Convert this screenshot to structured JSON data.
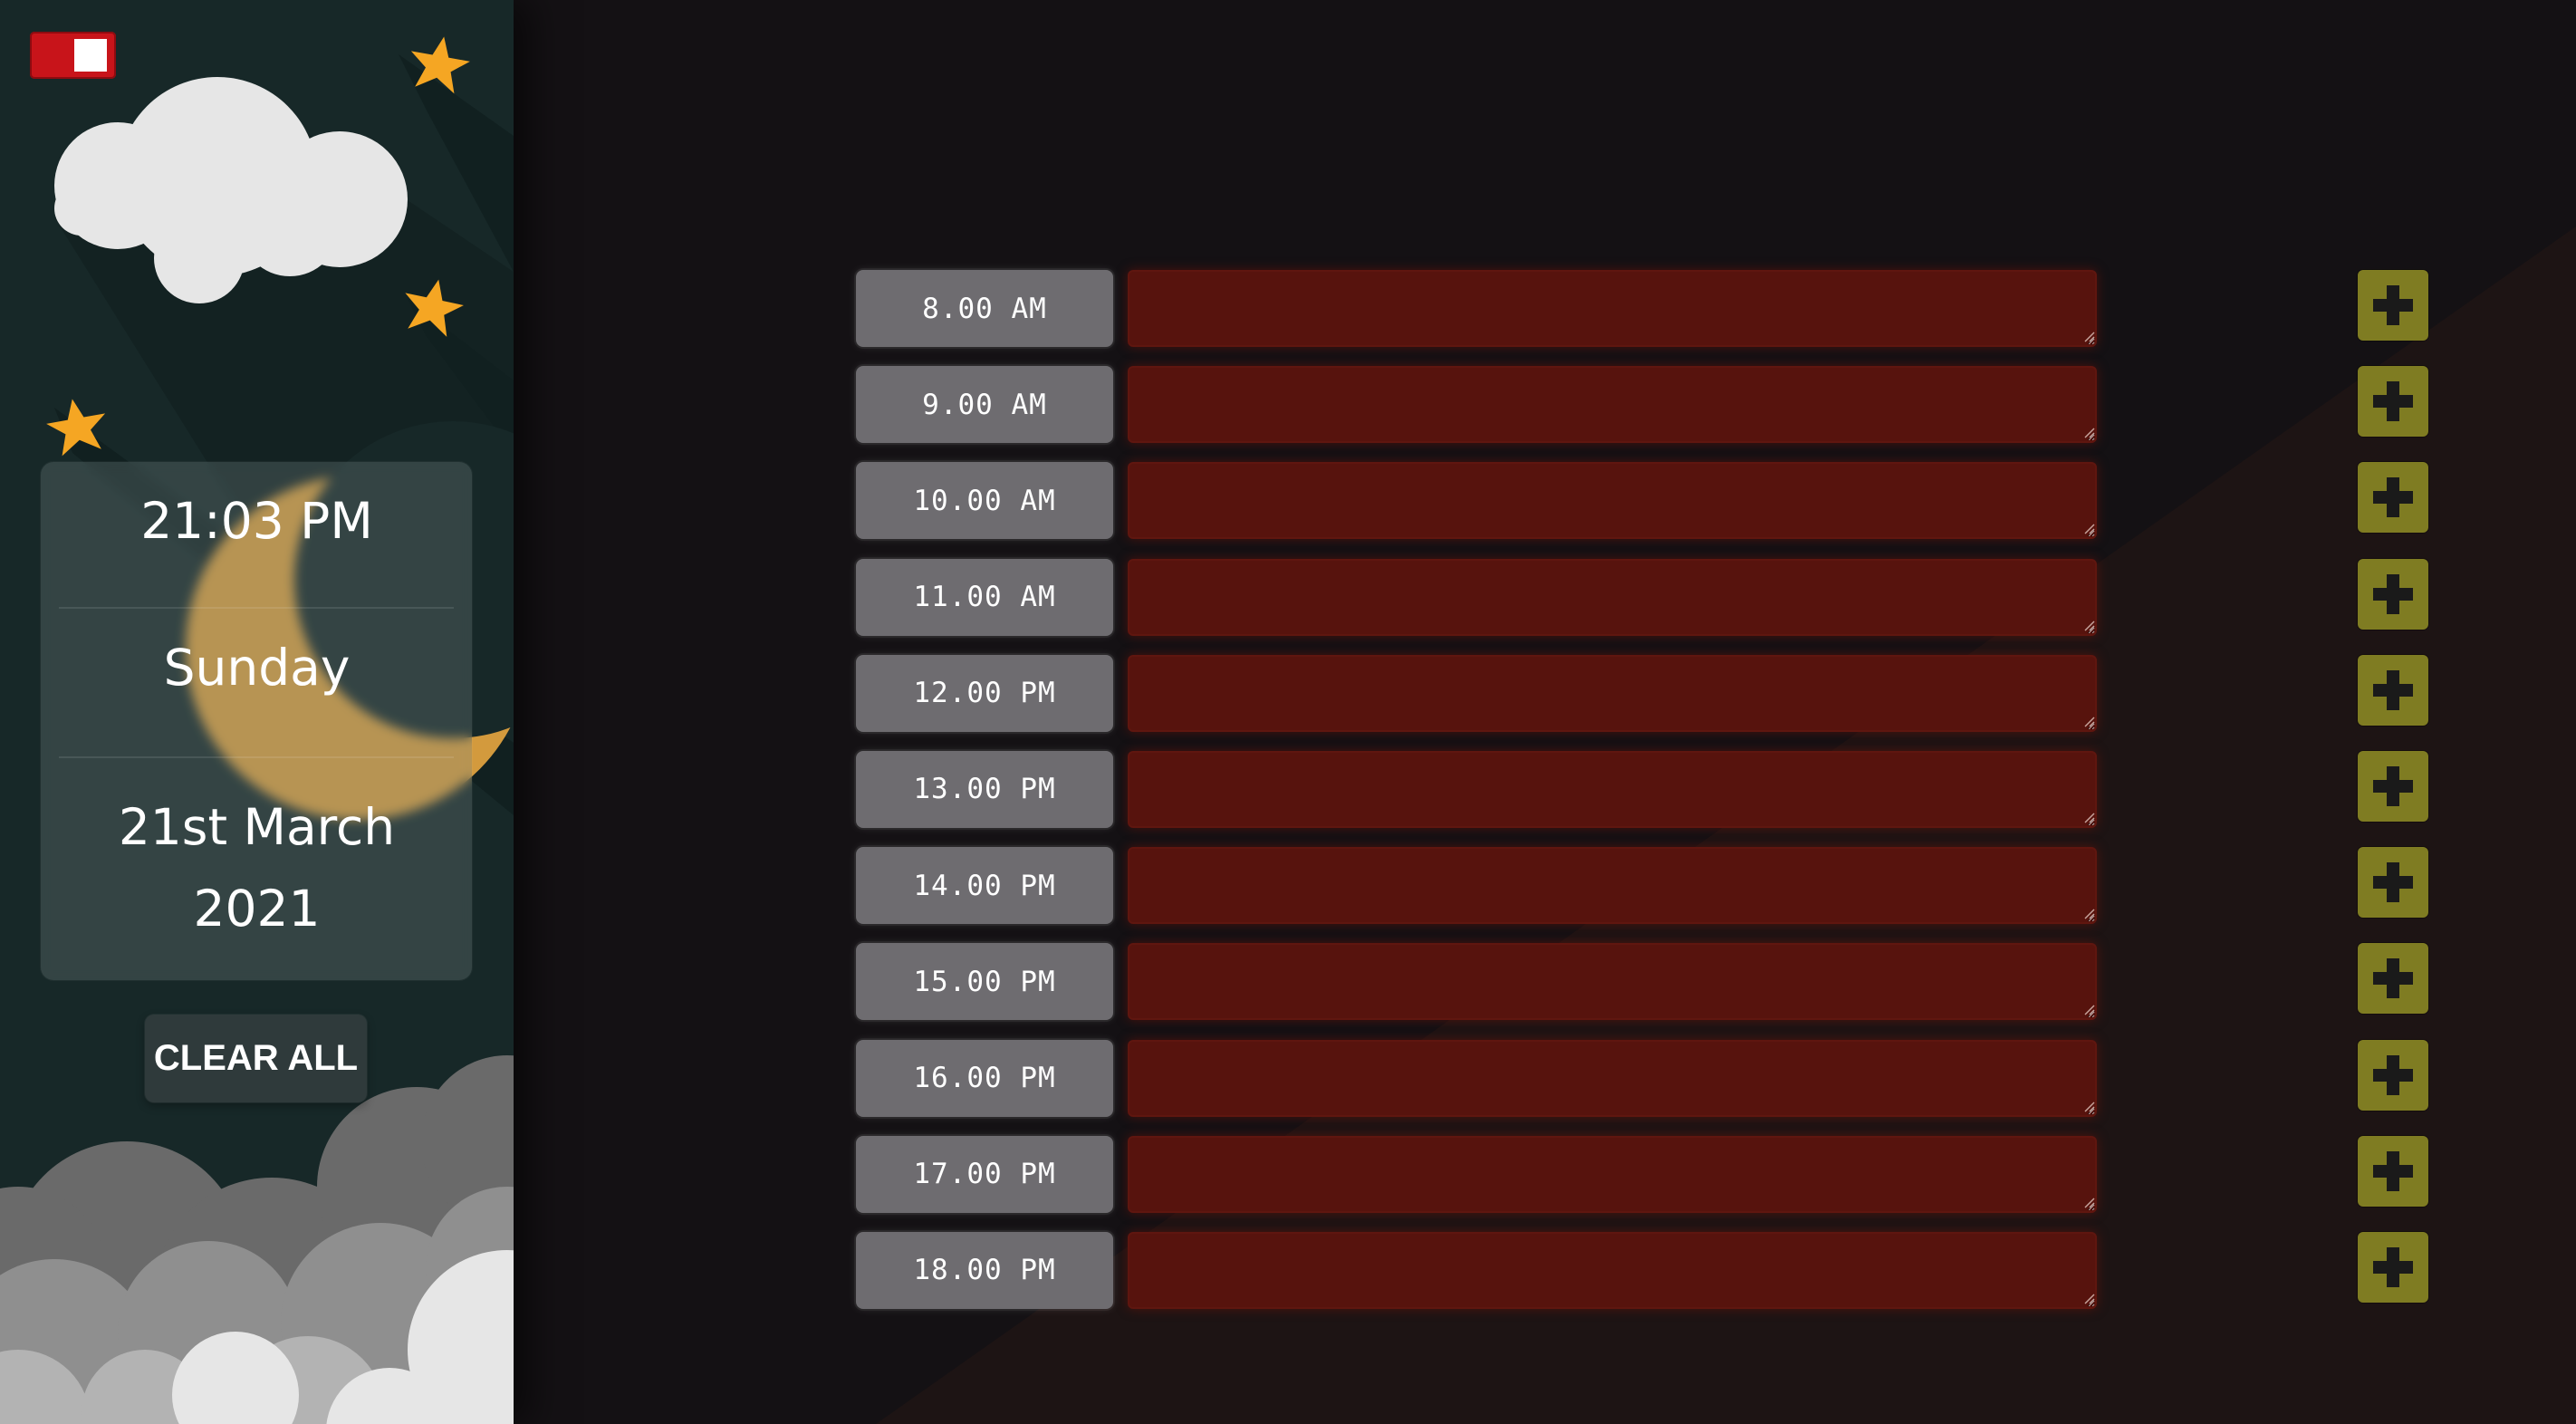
{
  "sidebar": {
    "time": "21:03 PM",
    "day": "Sunday",
    "date_line1": "21st March",
    "date_line2": "2021",
    "clear_all_label": "CLEAR ALL",
    "toggle_icon": "theme-toggle-icon"
  },
  "schedule": {
    "hours": [
      "8.00 AM",
      "9.00 AM",
      "10.00 AM",
      "11.00 AM",
      "12.00 PM",
      "13.00 PM",
      "14.00 PM",
      "15.00 PM",
      "16.00 PM",
      "17.00 PM",
      "18.00 PM"
    ],
    "save_icon": "plus-icon"
  },
  "colors": {
    "sidebar_bg": "#172828",
    "main_bg": "#141114",
    "toggle_red": "#c8141a",
    "hour_label_bg": "#6e6c70",
    "task_bg": "#57130d",
    "save_btn_bg": "#7f7c22",
    "star": "#f5a623",
    "moon": "#c8923a"
  }
}
